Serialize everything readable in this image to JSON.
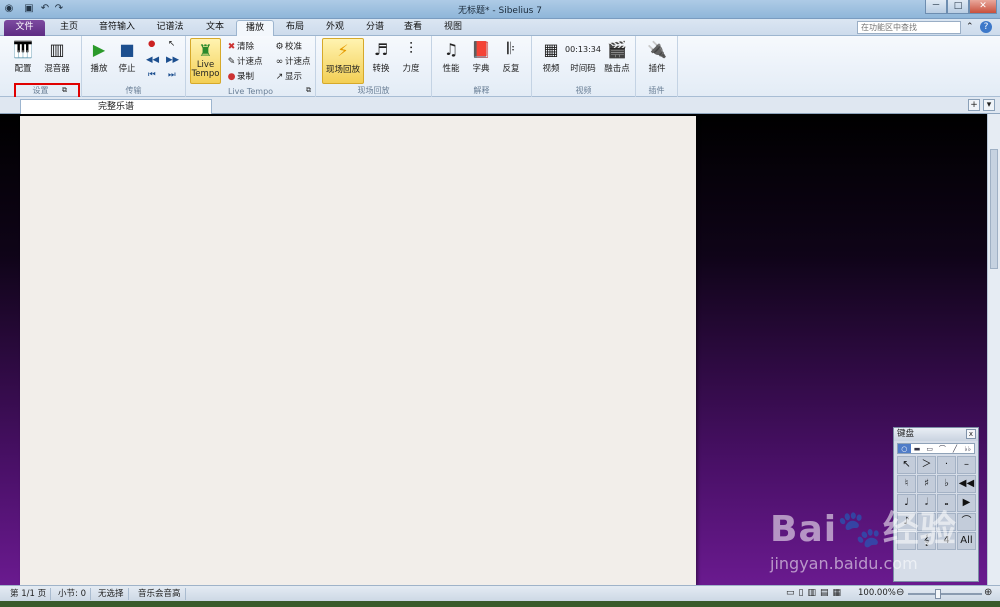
{
  "window": {
    "title": "无标题* - Sibelius 7",
    "minimize": "－",
    "maximize": "□",
    "close": "✕"
  },
  "quick_access": {
    "app_icon": "sibelius-logo",
    "save_icon": "save-icon",
    "undo_icon": "undo-icon",
    "redo_icon": "redo-icon"
  },
  "tabs": [
    "文件",
    "主页",
    "音符输入",
    "记谱法",
    "文本",
    "播放",
    "布局",
    "外观",
    "分谱",
    "查看",
    "视图"
  ],
  "active_tab": "播放",
  "search": {
    "placeholder": "在功能区中查找"
  },
  "ribbon": {
    "setup": {
      "label": "设置",
      "config": "配置",
      "mixer": "混音器"
    },
    "transport": {
      "label": "传输",
      "play": "播放",
      "stop": "停止"
    },
    "live_tempo": {
      "label": "Live Tempo",
      "live_tempo_btn": "Live\nTempo",
      "clear": "清除",
      "tap_point": "计速点",
      "record": "录制",
      "calibrate": "校准",
      "tap_point2": "计速点",
      "show": "显示"
    },
    "interpretation_live": {
      "label": "现场回放",
      "live_playback": "现场回放",
      "transform": "转换",
      "dynamics": "力度"
    },
    "interpretation": {
      "label": "解释",
      "performance": "性能",
      "dictionary": "字典",
      "repeat": "反复"
    },
    "video": {
      "label": "视频",
      "video": "视频",
      "timecode": "时间码",
      "hitpoint": "融击点"
    },
    "plugins": {
      "label": "插件",
      "plugins": "插件"
    }
  },
  "document_tab": "完整乐谱",
  "keypad": {
    "title": "键盘",
    "tabs": [
      "○",
      "▬",
      "▭",
      "⌒",
      "╱",
      "♭♭"
    ],
    "keys": [
      "↖",
      "＞",
      "·",
      "–",
      "♮",
      "♯",
      "♭",
      "◀◀",
      "♩",
      "𝅗𝅥",
      "𝅝",
      "▶",
      "♪",
      "",
      "",
      "⌒",
      "",
      "𝄞",
      "4",
      "All"
    ]
  },
  "status": {
    "page": "第 1/1 页",
    "bar": "小节: 0",
    "selection": "无选择",
    "pitch": "音乐会音高",
    "zoom": "100.00%"
  },
  "watermark": {
    "line1": "Bai🐾经验",
    "line2": "jingyan.baidu.com"
  }
}
